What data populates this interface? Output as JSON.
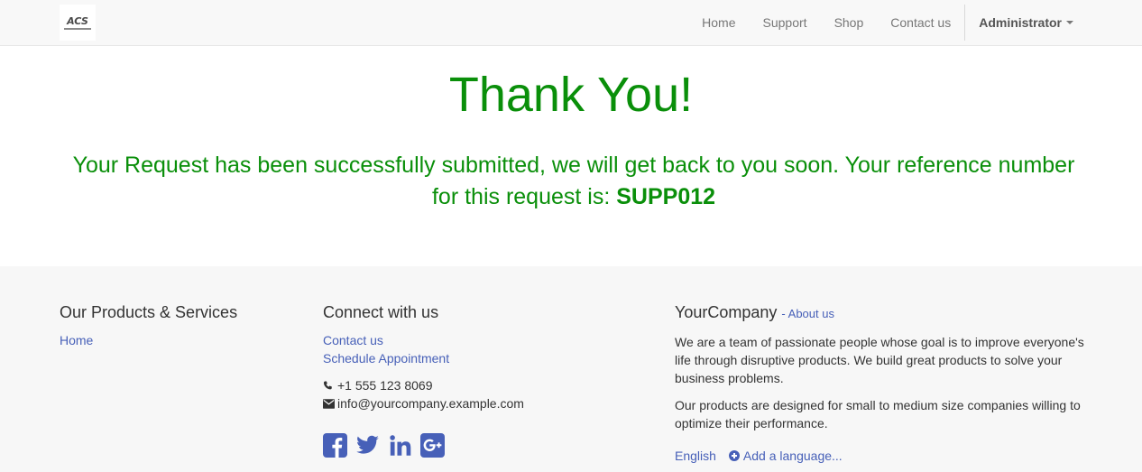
{
  "navbar": {
    "logo_text": "ACS",
    "items": [
      {
        "label": "Home"
      },
      {
        "label": "Support"
      },
      {
        "label": "Shop"
      },
      {
        "label": "Contact us"
      }
    ],
    "user_label": "Administrator"
  },
  "main": {
    "title": "Thank You!",
    "message": "Your Request has been successfully submitted, we will get back to you soon. Your reference number for this request is:",
    "reference_number": "SUPP012",
    "accent_color": "#0a8f0a"
  },
  "footer": {
    "products": {
      "heading": "Our Products & Services",
      "links": [
        {
          "label": "Home"
        }
      ]
    },
    "connect": {
      "heading": "Connect with us",
      "links": [
        {
          "label": "Contact us"
        },
        {
          "label": "Schedule Appointment"
        }
      ],
      "phone": "+1 555 123 8069",
      "email": "info@yourcompany.example.com",
      "social_icons": [
        "facebook-icon",
        "twitter-icon",
        "linkedin-icon",
        "google-plus-icon"
      ]
    },
    "company": {
      "name": "YourCompany",
      "about_link": "- About us",
      "paragraphs": [
        "We are a team of passionate people whose goal is to improve everyone's life through disruptive products. We build great products to solve your business problems.",
        "Our products are designed for small to medium size companies willing to optimize their performance."
      ],
      "language": "English",
      "add_language": "Add a language..."
    },
    "link_color": "#4760b8"
  }
}
